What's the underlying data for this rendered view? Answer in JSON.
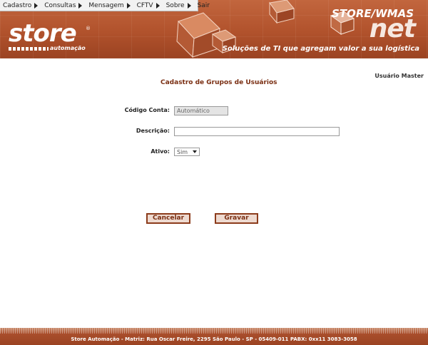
{
  "menu": [
    {
      "label": "Cadastro",
      "has_arrow": true
    },
    {
      "label": "Consultas",
      "has_arrow": true
    },
    {
      "label": "Mensagem",
      "has_arrow": true
    },
    {
      "label": "CFTV",
      "has_arrow": true
    },
    {
      "label": "Sobre",
      "has_arrow": true
    },
    {
      "label": "Sair",
      "has_arrow": false
    }
  ],
  "banner": {
    "logo_word": "store",
    "logo_sub": "automação",
    "logo_reg": "®",
    "title": "STORE/WMAS",
    "net": "net",
    "tagline": "Soluções de TI que agregam valor a sua logística"
  },
  "user": "Usuário Master",
  "page_title": "Cadastro de Grupos de Usuários",
  "form": {
    "codigo_label": "Código Conta:",
    "codigo_value": "Automático",
    "descricao_label": "Descrição:",
    "descricao_value": "",
    "ativo_label": "Ativo:",
    "ativo_value": "Sim"
  },
  "buttons": {
    "cancel": "Cancelar",
    "save": "Gravar"
  },
  "footer": "Store Automação - Matriz: Rua Oscar Freire, 2295 São Paulo - SP - 05409-011 PABX: 0xx11 3083-3058",
  "colors": {
    "banner": "#b1522c",
    "accent_text": "#7a2e12",
    "button_bg": "#eedad0"
  }
}
